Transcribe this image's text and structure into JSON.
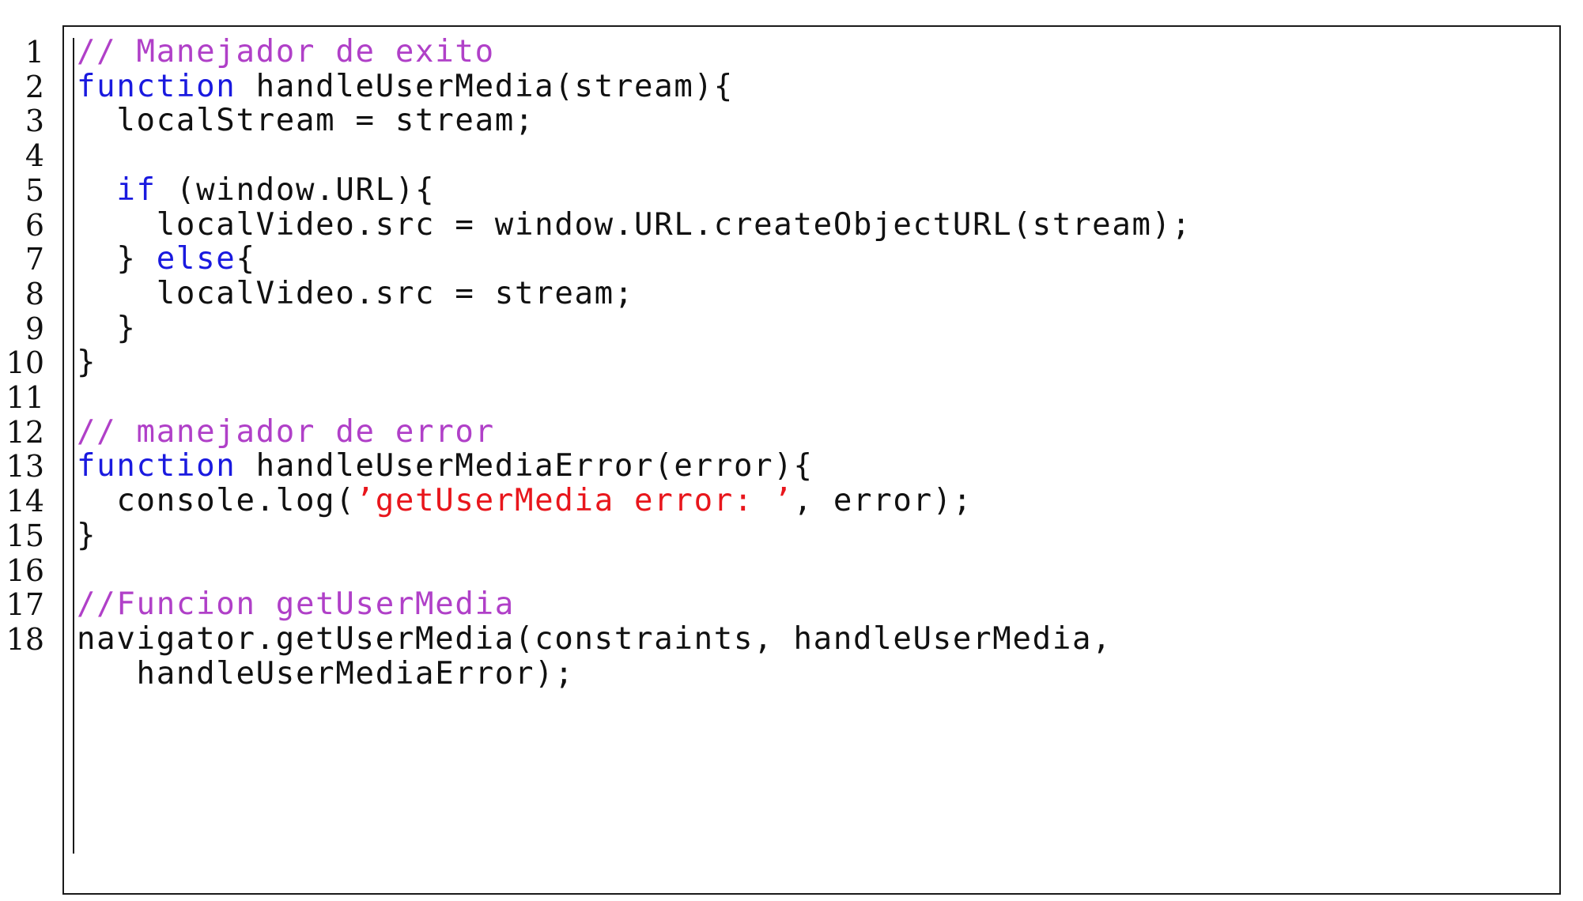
{
  "listing": {
    "lines": [
      {
        "number": "1",
        "segments": [
          {
            "text": "// Manejador de exito",
            "type": "comment"
          }
        ]
      },
      {
        "number": "2",
        "segments": [
          {
            "text": "function",
            "type": "keyword"
          },
          {
            "text": " handleUserMedia(stream){",
            "type": "plain"
          }
        ]
      },
      {
        "number": "3",
        "segments": [
          {
            "text": "  localStream = stream;",
            "type": "plain"
          }
        ]
      },
      {
        "number": "4",
        "segments": []
      },
      {
        "number": "5",
        "segments": [
          {
            "text": "  ",
            "type": "plain"
          },
          {
            "text": "if",
            "type": "keyword"
          },
          {
            "text": " (window.URL){",
            "type": "plain"
          }
        ]
      },
      {
        "number": "6",
        "segments": [
          {
            "text": "    localVideo.src = window.URL.createObjectURL(stream);",
            "type": "plain"
          }
        ]
      },
      {
        "number": "7",
        "segments": [
          {
            "text": "  } ",
            "type": "plain"
          },
          {
            "text": "else",
            "type": "keyword"
          },
          {
            "text": "{",
            "type": "plain"
          }
        ]
      },
      {
        "number": "8",
        "segments": [
          {
            "text": "    localVideo.src = stream;",
            "type": "plain"
          }
        ]
      },
      {
        "number": "9",
        "segments": [
          {
            "text": "  }",
            "type": "plain"
          }
        ]
      },
      {
        "number": "10",
        "segments": [
          {
            "text": "}",
            "type": "plain"
          }
        ]
      },
      {
        "number": "11",
        "segments": []
      },
      {
        "number": "12",
        "segments": [
          {
            "text": "// manejador de error",
            "type": "comment"
          }
        ]
      },
      {
        "number": "13",
        "segments": [
          {
            "text": "function",
            "type": "keyword"
          },
          {
            "text": " handleUserMediaError(error){",
            "type": "plain"
          }
        ]
      },
      {
        "number": "14",
        "segments": [
          {
            "text": "  console.log(",
            "type": "plain"
          },
          {
            "text": "’getUserMedia error: ’",
            "type": "string"
          },
          {
            "text": ", error);",
            "type": "plain"
          }
        ]
      },
      {
        "number": "15",
        "segments": [
          {
            "text": "}",
            "type": "plain"
          }
        ]
      },
      {
        "number": "16",
        "segments": []
      },
      {
        "number": "17",
        "segments": [
          {
            "text": "//Funcion getUserMedia",
            "type": "comment"
          }
        ]
      },
      {
        "number": "18",
        "segments": [
          {
            "text": "navigator.getUserMedia(constraints, handleUserMedia,",
            "type": "plain"
          }
        ]
      },
      {
        "number": "",
        "segments": [
          {
            "text": "   handleUserMediaError);",
            "type": "plain"
          }
        ]
      }
    ]
  },
  "colors": {
    "keyword": "#1a1adf",
    "comment": "#b040c8",
    "string": "#e8161c",
    "plain": "#111111"
  }
}
